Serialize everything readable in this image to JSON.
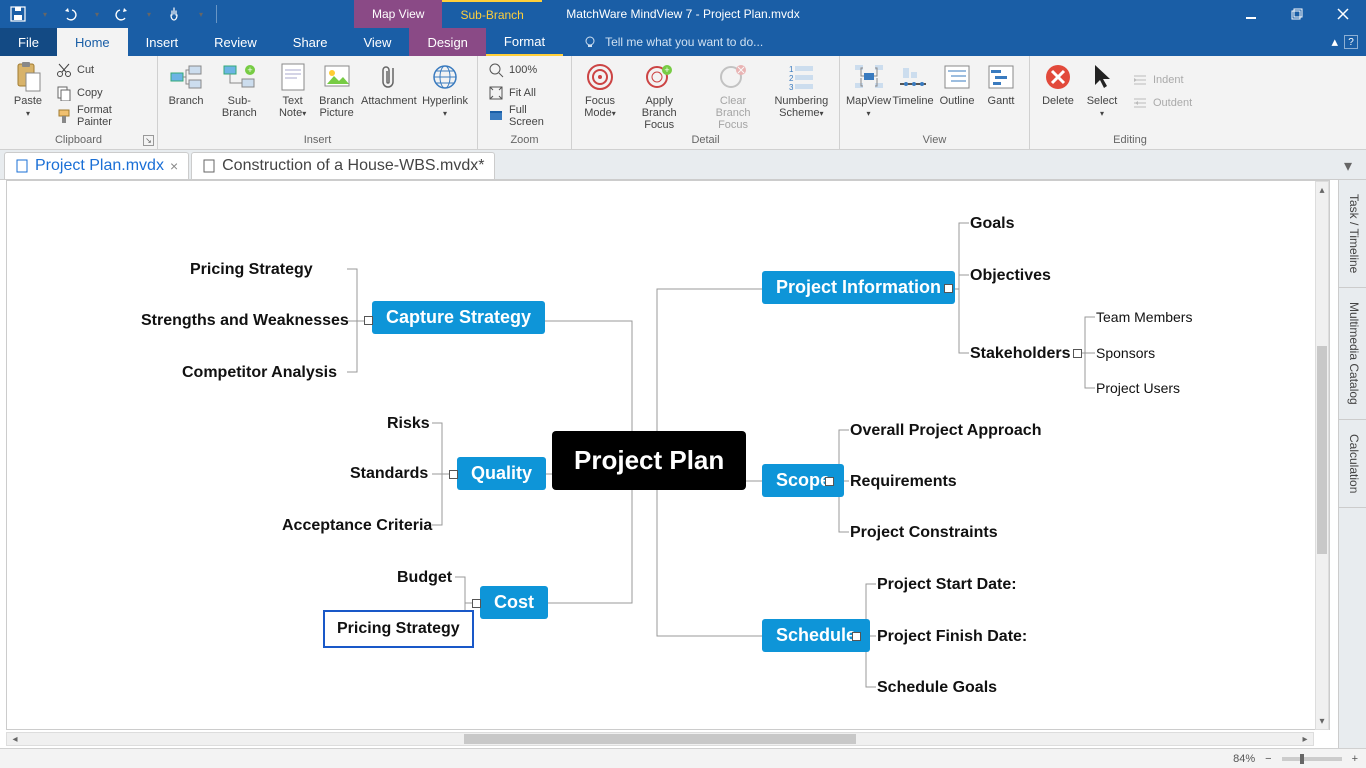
{
  "app_title": "MatchWare MindView 7 - Project Plan.mvdx",
  "qat": {
    "save": "💾",
    "undo": "↶",
    "redo": "↷",
    "touch": "👆"
  },
  "contextual": {
    "mapview": "Map View",
    "subbranch": "Sub-Branch"
  },
  "tabs": {
    "file": "File",
    "home": "Home",
    "insert": "Insert",
    "review": "Review",
    "share": "Share",
    "view": "View",
    "design": "Design",
    "format": "Format"
  },
  "tellme_placeholder": "Tell me what you want to do...",
  "ribbon": {
    "clipboard": {
      "label": "Clipboard",
      "paste": "Paste",
      "cut": "Cut",
      "copy": "Copy",
      "format_painter": "Format Painter"
    },
    "insert": {
      "label": "Insert",
      "branch": "Branch",
      "subbranch": "Sub-Branch",
      "textnote": "Text Note",
      "branch_picture": "Branch Picture",
      "attachment": "Attachment",
      "hyperlink": "Hyperlink"
    },
    "zoom": {
      "label": "Zoom",
      "z100": "100%",
      "fitall": "Fit All",
      "fullscreen": "Full Screen"
    },
    "detail": {
      "label": "Detail",
      "focus": "Focus Mode",
      "apply": "Apply Branch Focus",
      "clear": "Clear Branch Focus",
      "numbering": "Numbering Scheme"
    },
    "view": {
      "label": "View",
      "mapview": "MapView",
      "timeline": "Timeline",
      "outline": "Outline",
      "gantt": "Gantt"
    },
    "editing": {
      "label": "Editing",
      "delete": "Delete",
      "select": "Select",
      "indent": "Indent",
      "outdent": "Outdent"
    }
  },
  "doctabs": {
    "active": "Project Plan.mvdx",
    "second": "Construction of a House-WBS.mvdx*"
  },
  "mindmap": {
    "root": "Project Plan",
    "left": {
      "capture": {
        "label": "Capture Strategy",
        "children": [
          "Pricing Strategy",
          "Strengths and Weaknesses",
          "Competitor Analysis"
        ]
      },
      "quality": {
        "label": "Quality",
        "children": [
          "Risks",
          "Standards",
          "Acceptance Criteria"
        ]
      },
      "cost": {
        "label": "Cost",
        "children": [
          "Budget",
          "Pricing Strategy"
        ]
      }
    },
    "right": {
      "projinfo": {
        "label": "Project Information",
        "children": [
          "Goals",
          "Objectives",
          "Stakeholders"
        ],
        "stakeholders_children": [
          "Team Members",
          "Sponsors",
          "Project Users"
        ]
      },
      "scope": {
        "label": "Scope",
        "children": [
          "Overall Project Approach",
          "Requirements",
          "Project Constraints"
        ]
      },
      "schedule": {
        "label": "Schedule",
        "children": [
          "Project Start Date:",
          "Project Finish Date:",
          "Schedule Goals"
        ]
      }
    }
  },
  "sidepanels": [
    "Task / Timeline",
    "Multimedia Catalog",
    "Calculation"
  ],
  "status": {
    "zoom": "84%"
  }
}
